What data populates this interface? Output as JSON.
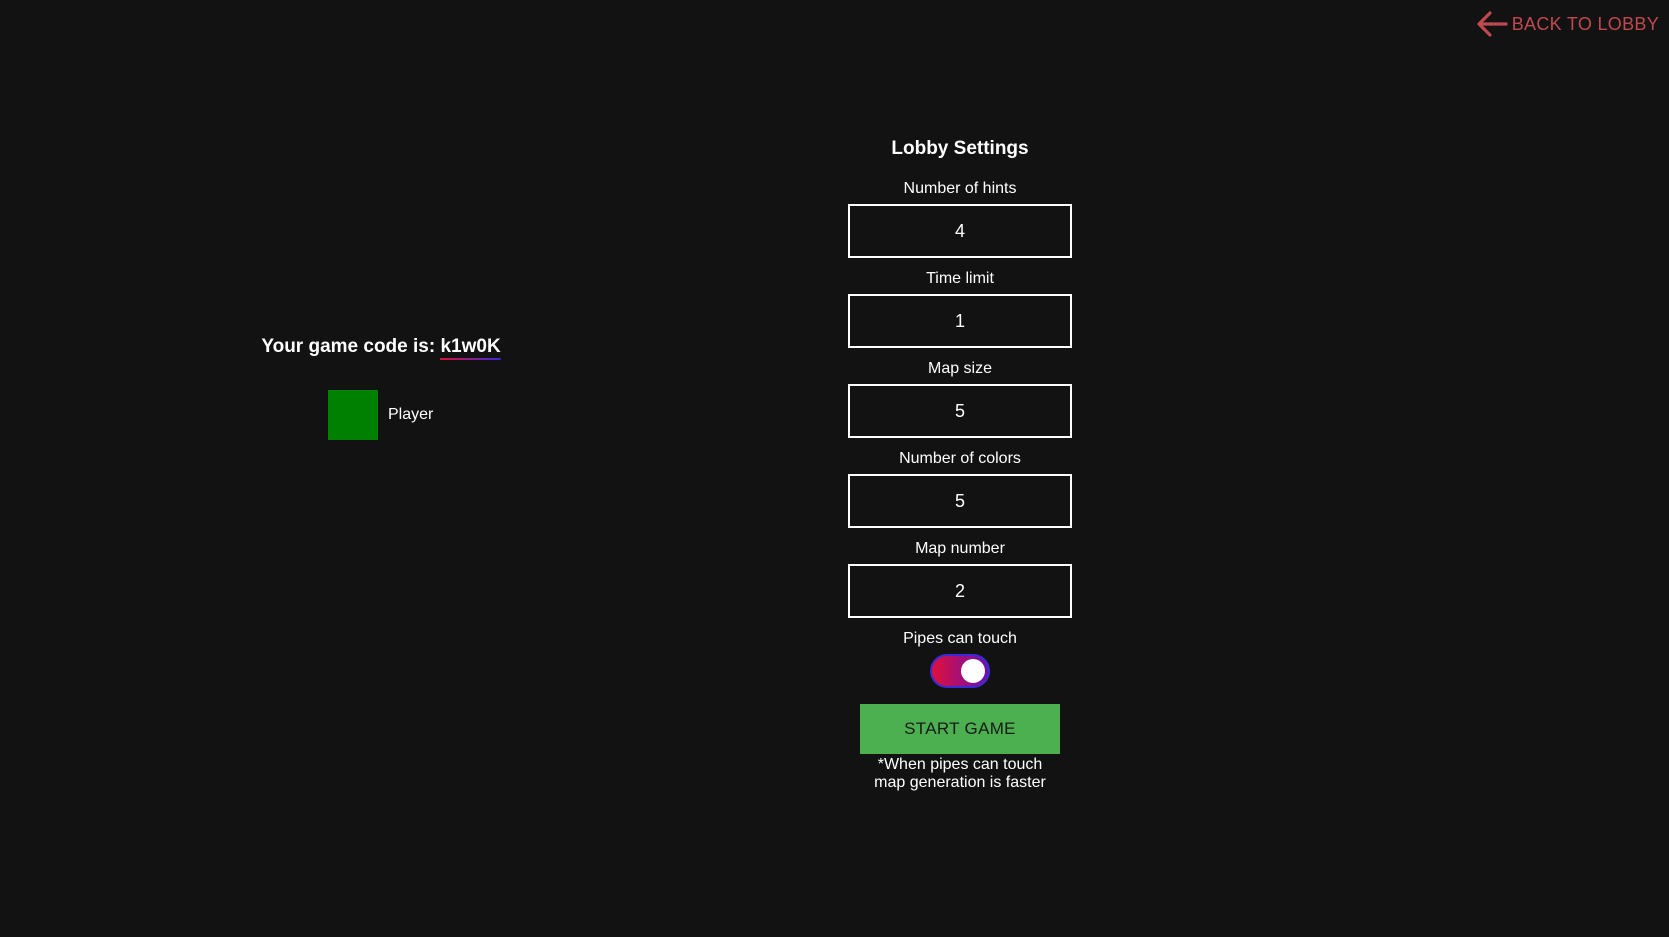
{
  "nav": {
    "back_label": "BACK TO LOBBY",
    "back_icon": "arrow-left-icon",
    "back_color": "#c0494f"
  },
  "game": {
    "code_prefix": "Your game code is: ",
    "code": "k1w0K"
  },
  "players": [
    {
      "name": "Player",
      "color": "#008000"
    }
  ],
  "settings": {
    "title": "Lobby Settings",
    "fields": [
      {
        "label": "Number of hints",
        "value": "4"
      },
      {
        "label": "Time limit",
        "value": "1"
      },
      {
        "label": "Map size",
        "value": "5"
      },
      {
        "label": "Number of colors",
        "value": "5"
      },
      {
        "label": "Map number",
        "value": "2"
      }
    ],
    "pipes_can_touch": {
      "label": "Pipes can touch",
      "enabled": true
    },
    "start_label": "START GAME",
    "start_color": "#4caf50",
    "note_line1": "*When pipes can touch",
    "note_line2": "map generation is faster"
  }
}
